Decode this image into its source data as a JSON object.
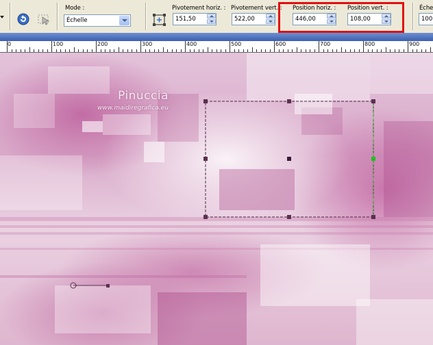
{
  "toolbar": {
    "mode_label": "Mode :",
    "mode_value": "Échelle",
    "pivot_h_label": "Pivotement horiz. :",
    "pivot_h_value": "151,50",
    "pivot_v_label": "Pivotement vert. :",
    "pivot_v_value": "522,00",
    "pos_h_label": "Position horiz. :",
    "pos_h_value": "446,00",
    "pos_v_label": "Position vert. :",
    "pos_v_value": "108,00",
    "scale_label": "Éche",
    "scale_value": "100"
  },
  "ruler": {
    "labels": [
      "0",
      "100",
      "200",
      "300",
      "400",
      "500",
      "600",
      "700",
      "800",
      "900"
    ]
  },
  "watermark": {
    "name": "Pinuccia",
    "url": "www.maidiregrafica.eu"
  },
  "colors": {
    "highlight_box": "#e01010",
    "handle": "#5a3050",
    "active_handle": "#19c419"
  },
  "icons": [
    "undo-icon",
    "pointer-icon",
    "pivot-icon"
  ]
}
